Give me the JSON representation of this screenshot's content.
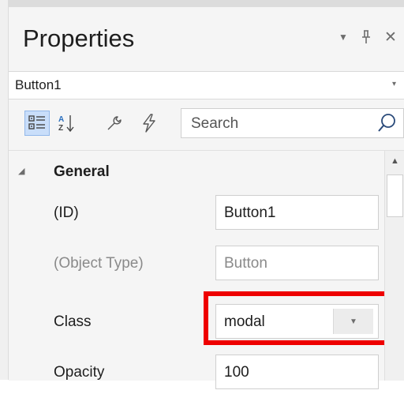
{
  "panel": {
    "title": "Properties",
    "header_buttons": {
      "dropdown_icon": "chevron-down-icon",
      "pin_icon": "pin-icon",
      "close_icon": "close-icon",
      "dropdown_glyph": "▼",
      "pin_glyph": "ᖚ",
      "close_glyph": "✕"
    }
  },
  "object_selector": {
    "value": "Button1",
    "arrow_glyph": "▾"
  },
  "toolbar": {
    "categorized_icon": "categorized-view-icon",
    "alphabetical_icon": "sort-alphabetical-icon",
    "properties_icon": "wrench-icon",
    "events_icon": "lightning-icon",
    "search_placeholder": "Search",
    "search_value": ""
  },
  "grid": {
    "category": {
      "label": "General",
      "arrow_glyph": "◢"
    },
    "properties": [
      {
        "label": "(ID)",
        "value": "Button1",
        "disabled": false
      },
      {
        "label": "(Object Type)",
        "value": "Button",
        "disabled": true
      },
      {
        "label": "Class",
        "value": "modal",
        "disabled": false,
        "type": "dropdown"
      },
      {
        "label": "Opacity",
        "value": "100",
        "disabled": false
      }
    ],
    "scroll_up_glyph": "▲"
  },
  "colors": {
    "highlight": "#ee0000",
    "selected_toolbar_button": "#c9defa",
    "panel_background": "#f5f5f5"
  }
}
